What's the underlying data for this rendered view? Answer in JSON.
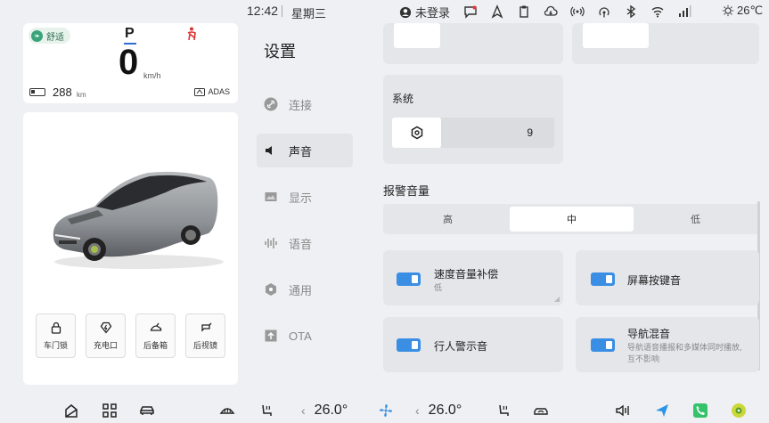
{
  "status_bar": {
    "time": "12:42",
    "weekday": "星期三",
    "user": "未登录",
    "temperature": "26℃"
  },
  "dashboard": {
    "drive_mode": "舒适",
    "gear": "P",
    "speed": "0",
    "speed_unit": "km/h",
    "range": "288",
    "range_unit": "km",
    "adas": "ADAS"
  },
  "quick_controls": [
    {
      "label": "车门锁",
      "icon": "lock-icon"
    },
    {
      "label": "充电口",
      "icon": "charge-port-icon"
    },
    {
      "label": "后备箱",
      "icon": "trunk-icon"
    },
    {
      "label": "后视镜",
      "icon": "mirror-icon"
    }
  ],
  "settings": {
    "title": "设置",
    "nav": [
      {
        "label": "连接",
        "icon": "link-icon"
      },
      {
        "label": "声音",
        "icon": "speaker-icon"
      },
      {
        "label": "显示",
        "icon": "display-icon"
      },
      {
        "label": "语音",
        "icon": "voice-icon"
      },
      {
        "label": "通用",
        "icon": "general-icon"
      },
      {
        "label": "OTA",
        "icon": "ota-icon"
      }
    ],
    "active_nav": "声音"
  },
  "sound": {
    "system_label": "系统",
    "system_value": "9",
    "alert_volume_title": "报警音量",
    "alert_volume_options": [
      "高",
      "中",
      "低"
    ],
    "alert_volume_selected": "中",
    "toggles": [
      {
        "title": "速度音量补偿",
        "subtitle": "低",
        "on": true
      },
      {
        "title": "屏幕按键音",
        "subtitle": "",
        "on": true
      },
      {
        "title": "行人警示音",
        "subtitle": "",
        "on": true
      },
      {
        "title": "导航混音",
        "subtitle": "导航语音播报和多媒体同时播放,互不影响",
        "on": true
      }
    ]
  },
  "bottom_bar": {
    "driver_temp": "26.0°",
    "passenger_temp": "26.0°"
  },
  "colors": {
    "accent": "#3a8ee3",
    "background": "#eef0f3",
    "card": "#e4e6ea"
  }
}
